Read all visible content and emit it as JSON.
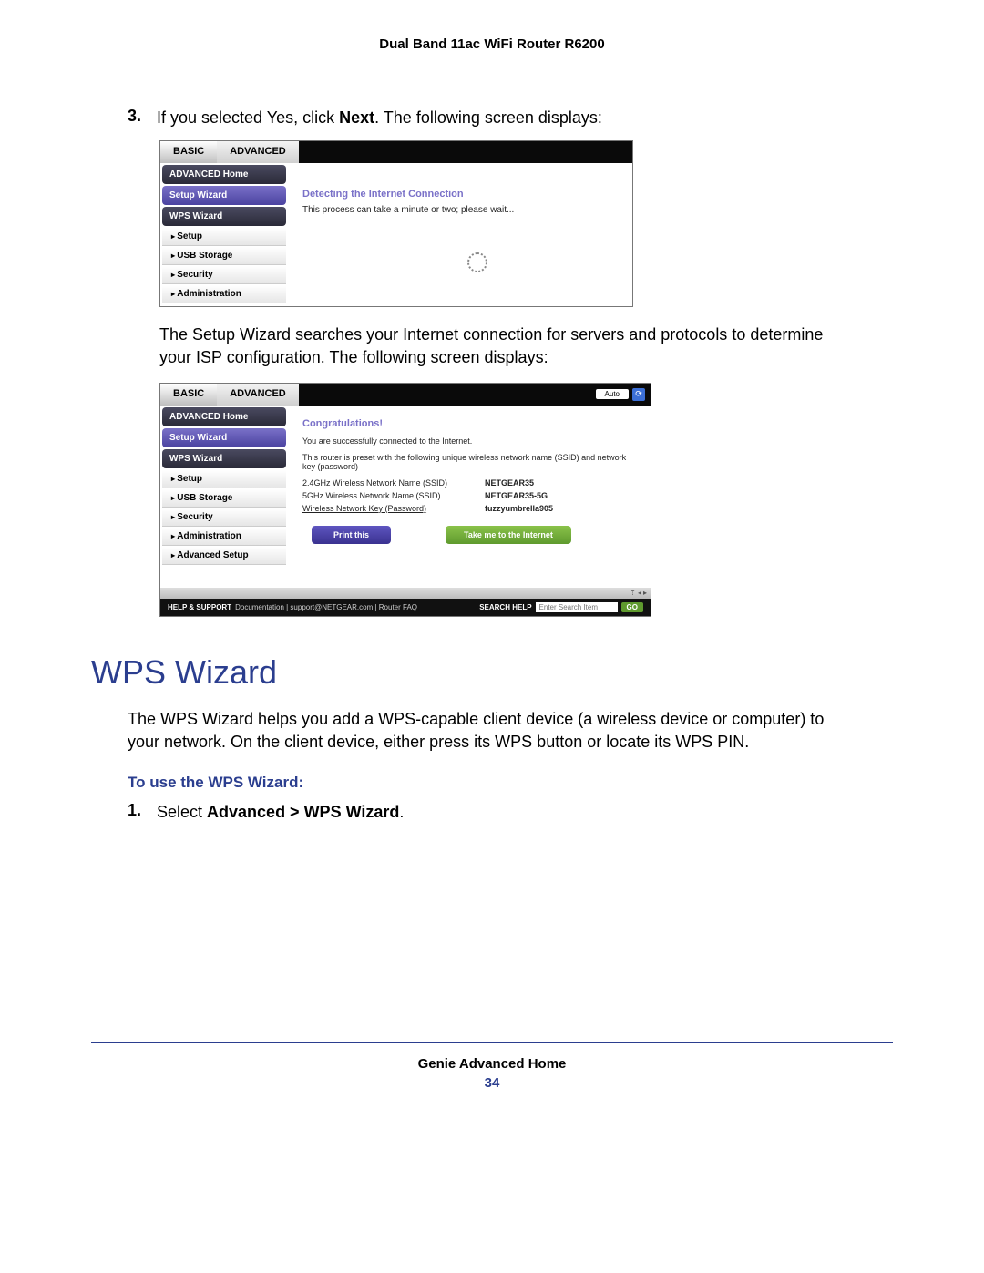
{
  "header": {
    "title": "Dual Band 11ac WiFi Router R6200"
  },
  "step3": {
    "num": "3.",
    "prefix": "If you selected Yes, click ",
    "bold": "Next",
    "suffix": ". The following screen displays:"
  },
  "shot1": {
    "tabs": {
      "basic": "BASIC",
      "advanced": "ADVANCED"
    },
    "sidebar": {
      "advHome": "ADVANCED Home",
      "setupWiz": "Setup Wizard",
      "wpsWiz": "WPS Wizard",
      "setup": "Setup",
      "usb": "USB Storage",
      "security": "Security",
      "admin": "Administration"
    },
    "main": {
      "detecting": "Detecting the Internet Connection",
      "process": "This process can take a minute or two; please wait..."
    }
  },
  "mid_para": "The Setup Wizard searches your Internet connection for servers and protocols to determine your ISP configuration. The following screen displays:",
  "shot2": {
    "auto": "Auto",
    "sidebar": {
      "advHome": "ADVANCED Home",
      "setupWiz": "Setup Wizard",
      "wpsWiz": "WPS Wizard",
      "setup": "Setup",
      "usb": "USB Storage",
      "security": "Security",
      "admin": "Administration",
      "advSetup": "Advanced Setup"
    },
    "main": {
      "congrats": "Congratulations!",
      "connected": "You are successfully connected to the Internet.",
      "preset": "This router is preset with the following unique wireless network name (SSID) and network key (password)",
      "rows": [
        {
          "k": "2.4GHz Wireless Network Name (SSID)",
          "v": "NETGEAR35",
          "u": false
        },
        {
          "k": "5GHz Wireless Network Name (SSID)",
          "v": "NETGEAR35-5G",
          "u": false
        },
        {
          "k": "Wireless Network Key (Password)",
          "v": "fuzzyumbrella905",
          "u": true
        }
      ],
      "btn_print": "Print this",
      "btn_take": "Take me to the Internet"
    },
    "helpbar": {
      "label": "HELP & SUPPORT",
      "links": "Documentation | support@NETGEAR.com | Router FAQ",
      "searchLabel": "SEARCH HELP",
      "placeholder": "Enter Search Item",
      "go": "GO"
    }
  },
  "section_title": "WPS Wizard",
  "wps_para": "The WPS Wizard helps you add a WPS-capable client device (a wireless device or computer) to your network. On the client device, either press its WPS button or locate its WPS PIN.",
  "sub_heading": "To use the WPS Wizard:",
  "step1": {
    "num": "1.",
    "prefix": "Select ",
    "bold": "Advanced > WPS Wizard",
    "suffix": "."
  },
  "footer": {
    "chapter": "Genie Advanced Home",
    "page": "34"
  }
}
